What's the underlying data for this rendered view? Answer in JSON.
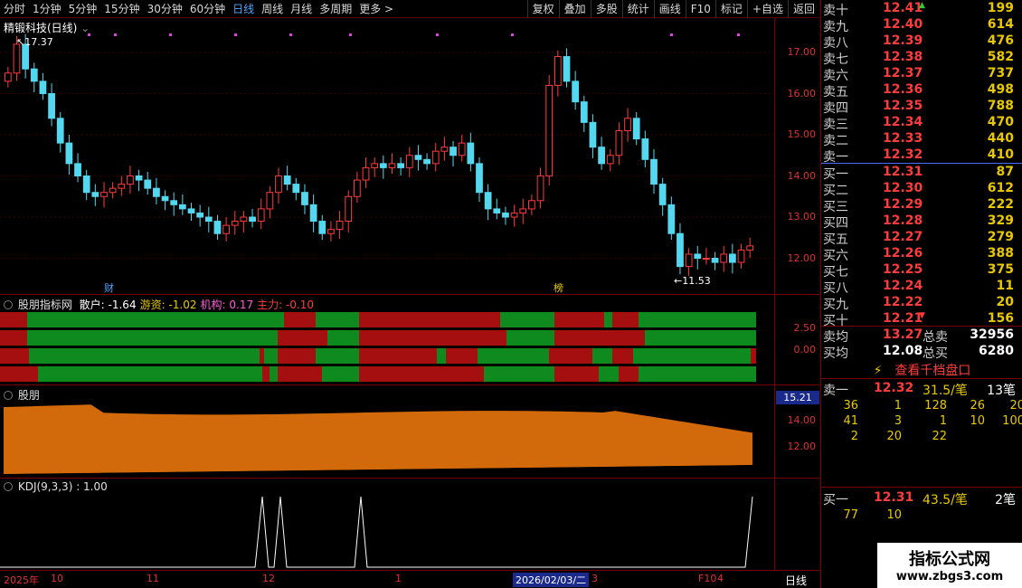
{
  "toolbar": {
    "periods": [
      "分时",
      "1分钟",
      "5分钟",
      "15分钟",
      "30分钟",
      "60分钟",
      "日线",
      "周线",
      "月线",
      "多周期",
      "更多"
    ],
    "tools": [
      "复权",
      "叠加",
      "多股",
      "统计",
      "画线",
      "F10",
      "标记",
      "+自选",
      "返回"
    ]
  },
  "main": {
    "title": "精锻科技(日线)",
    "high_label": "17.37",
    "low_label": "11.53",
    "axis": [
      "17.00",
      "16.00",
      "15.00",
      "14.00",
      "13.00",
      "12.00"
    ],
    "marks": [
      "财",
      "榜"
    ],
    "colors": {
      "up": "#ff3b3b",
      "down": "#54d8f0",
      "grid": "#3a0000"
    }
  },
  "indicator1": {
    "title": "股朋指标网",
    "values": [
      {
        "label": "散户: -1.64",
        "color": "#ffffff"
      },
      {
        "label": "游资: -1.02",
        "color": "#e8c800"
      },
      {
        "label": "机构: 0.17",
        "color": "#ff5bd8"
      },
      {
        "label": "主力: -0.10",
        "color": "#ff3b3b"
      }
    ],
    "axis": [
      "2.50",
      "0.00"
    ]
  },
  "indicator2": {
    "title": "股朋",
    "current": "15.21",
    "axis": [
      "14.00",
      "12.00"
    ],
    "fill": "#d2690a"
  },
  "indicator3": {
    "title": "KDJ(9,3,3) : 1.00"
  },
  "timeline": {
    "labels": [
      "2025年",
      "10",
      "11",
      "12",
      "1",
      "2026/02/03/二",
      "3",
      "F10",
      "4"
    ],
    "period": "日线"
  },
  "book": {
    "asks": [
      {
        "label": "卖十",
        "price": "12.41",
        "vol": "199"
      },
      {
        "label": "卖九",
        "price": "12.40",
        "vol": "614"
      },
      {
        "label": "卖八",
        "price": "12.39",
        "vol": "476"
      },
      {
        "label": "卖七",
        "price": "12.38",
        "vol": "582"
      },
      {
        "label": "卖六",
        "price": "12.37",
        "vol": "737"
      },
      {
        "label": "卖五",
        "price": "12.36",
        "vol": "498"
      },
      {
        "label": "卖四",
        "price": "12.35",
        "vol": "788"
      },
      {
        "label": "卖三",
        "price": "12.34",
        "vol": "470"
      },
      {
        "label": "卖二",
        "price": "12.33",
        "vol": "440"
      },
      {
        "label": "卖一",
        "price": "12.32",
        "vol": "410"
      }
    ],
    "bids": [
      {
        "label": "买一",
        "price": "12.31",
        "vol": "87"
      },
      {
        "label": "买二",
        "price": "12.30",
        "vol": "612"
      },
      {
        "label": "买三",
        "price": "12.29",
        "vol": "222"
      },
      {
        "label": "买四",
        "price": "12.28",
        "vol": "329"
      },
      {
        "label": "买五",
        "price": "12.27",
        "vol": "279"
      },
      {
        "label": "买六",
        "price": "12.26",
        "vol": "388"
      },
      {
        "label": "买七",
        "price": "12.25",
        "vol": "375"
      },
      {
        "label": "买八",
        "price": "12.24",
        "vol": "11"
      },
      {
        "label": "买九",
        "price": "12.22",
        "vol": "20"
      },
      {
        "label": "买十",
        "price": "12.21",
        "vol": "156"
      }
    ],
    "ask_avg": {
      "label": "卖均",
      "price": "13.27",
      "tlabel": "总卖",
      "total": "32956"
    },
    "bid_avg": {
      "label": "买均",
      "price": "12.08",
      "tlabel": "总买",
      "total": "6280"
    },
    "depth_link": "查看千档盘口",
    "sell1": {
      "label": "卖一",
      "price": "12.32",
      "per": "31.5/笔",
      "count": "13笔",
      "grid": [
        "36",
        "1",
        "128",
        "26",
        "20",
        "41",
        "3",
        "1",
        "10",
        "100",
        "2",
        "20",
        "22"
      ]
    },
    "buy1": {
      "label": "买一",
      "price": "12.31",
      "per": "43.5/笔",
      "count": "2笔",
      "grid": [
        "77",
        "10"
      ]
    }
  },
  "watermark": {
    "line1": "指标公式网",
    "line2": "www.zbgs3.com"
  }
}
